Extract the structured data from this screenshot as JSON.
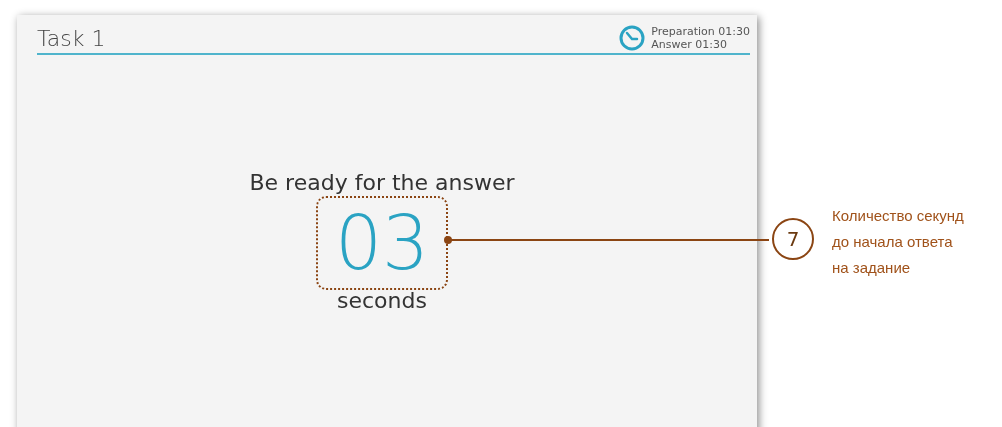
{
  "screen": {
    "title": "Task 1",
    "timers": [
      "Preparation 01:30",
      "Answer 01:30"
    ],
    "prompt": "Be ready for the answer",
    "countdown": "03",
    "unit": "seconds"
  },
  "callout": {
    "number": "7",
    "text": [
      "Количество секунд",
      "до начала ответа",
      "на задание"
    ]
  }
}
